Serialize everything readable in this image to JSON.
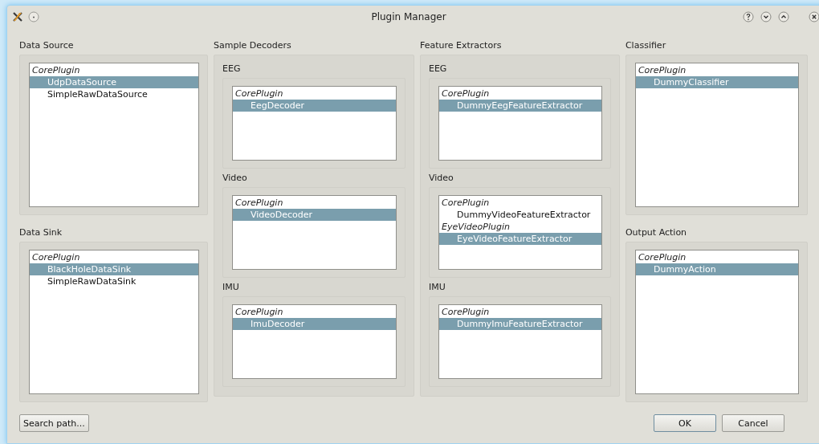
{
  "window": {
    "title": "Plugin Manager"
  },
  "columns": [
    {
      "groups": [
        {
          "title": "Data Source",
          "kind": "list",
          "plugins": [
            {
              "name": "CorePlugin",
              "items": [
                {
                  "label": "UdpDataSource",
                  "selected": true
                },
                {
                  "label": "SimpleRawDataSource",
                  "selected": false
                }
              ]
            }
          ]
        },
        {
          "title": "Data Sink",
          "kind": "list",
          "plugins": [
            {
              "name": "CorePlugin",
              "items": [
                {
                  "label": "BlackHoleDataSink",
                  "selected": true
                },
                {
                  "label": "SimpleRawDataSink",
                  "selected": false
                }
              ]
            }
          ]
        }
      ]
    },
    {
      "groups": [
        {
          "title": "Sample Decoders",
          "kind": "nested",
          "subgroups": [
            {
              "title": "EEG",
              "plugins": [
                {
                  "name": "CorePlugin",
                  "items": [
                    {
                      "label": "EegDecoder",
                      "selected": true
                    }
                  ]
                }
              ]
            },
            {
              "title": "Video",
              "plugins": [
                {
                  "name": "CorePlugin",
                  "items": [
                    {
                      "label": "VideoDecoder",
                      "selected": true
                    }
                  ]
                }
              ]
            },
            {
              "title": "IMU",
              "plugins": [
                {
                  "name": "CorePlugin",
                  "items": [
                    {
                      "label": "ImuDecoder",
                      "selected": true
                    }
                  ]
                }
              ]
            }
          ]
        }
      ]
    },
    {
      "groups": [
        {
          "title": "Feature Extractors",
          "kind": "nested",
          "subgroups": [
            {
              "title": "EEG",
              "plugins": [
                {
                  "name": "CorePlugin",
                  "items": [
                    {
                      "label": "DummyEegFeatureExtractor",
                      "selected": true
                    }
                  ]
                }
              ]
            },
            {
              "title": "Video",
              "plugins": [
                {
                  "name": "CorePlugin",
                  "items": [
                    {
                      "label": "DummyVideoFeatureExtractor",
                      "selected": false
                    }
                  ]
                },
                {
                  "name": "EyeVideoPlugin",
                  "items": [
                    {
                      "label": "EyeVideoFeatureExtractor",
                      "selected": true
                    }
                  ]
                }
              ]
            },
            {
              "title": "IMU",
              "plugins": [
                {
                  "name": "CorePlugin",
                  "items": [
                    {
                      "label": "DummyImuFeatureExtractor",
                      "selected": true
                    }
                  ]
                }
              ]
            }
          ]
        }
      ]
    },
    {
      "groups": [
        {
          "title": "Classifier",
          "kind": "list",
          "plugins": [
            {
              "name": "CorePlugin",
              "items": [
                {
                  "label": "DummyClassifier",
                  "selected": true
                }
              ]
            }
          ]
        },
        {
          "title": "Output Action",
          "kind": "list",
          "plugins": [
            {
              "name": "CorePlugin",
              "items": [
                {
                  "label": "DummyAction",
                  "selected": true
                }
              ]
            }
          ]
        }
      ]
    }
  ],
  "buttons": {
    "left": [
      "Search path..."
    ],
    "right": [
      {
        "label": "OK",
        "default": true
      },
      {
        "label": "Cancel",
        "default": false
      }
    ]
  }
}
